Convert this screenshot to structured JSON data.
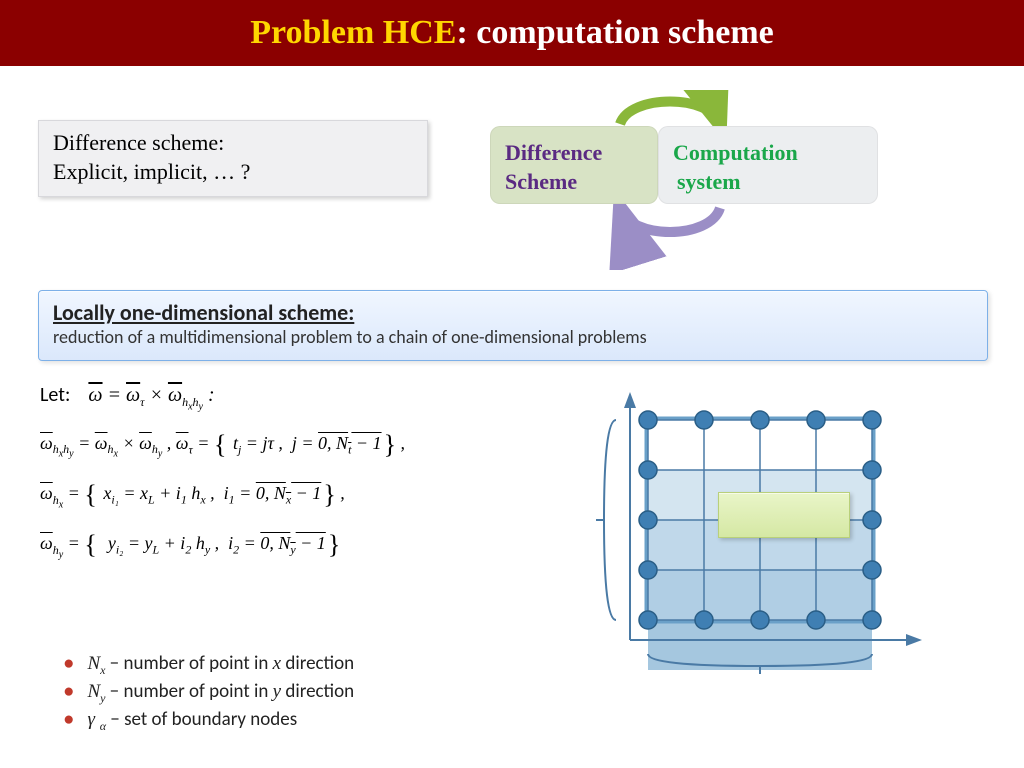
{
  "title": {
    "yellow": "Problem HCE",
    "rest": ": computation scheme"
  },
  "question": {
    "line1": "Difference scheme:",
    "line2": "Explicit,  implicit, … ?"
  },
  "cycle": {
    "left_line1": "Difference",
    "left_line2": "Scheme",
    "right_line1": "Computation",
    "right_line2": "system"
  },
  "lod": {
    "heading": "Locally one-dimensional scheme:",
    "sub": "reduction of a multidimensional problem to a chain of one-dimensional problems"
  },
  "math": {
    "let_label": "Let:",
    "line0_a": "ω̄ = ω̄",
    "line0_b": " × ω̄",
    "line0_tau": "τ",
    "line0_hxhy": "hₓh_y",
    "line0_tail": " :",
    "line1_lhs": "ω̄",
    "line1_hxhy": "hₓh_y",
    "line1_mid": " = ω̄",
    "line1_hx": "hₓ",
    "line1_x": " × ω̄",
    "line1_hy": "h_y",
    "line1_tau_lead": " , ω̄",
    "line1_tau": "τ",
    "line1_set": " = { t_j = jτ ,  j = 0, N_t − 1 } ,",
    "line2_lhs": "ω̄",
    "line2_hx": "hₓ",
    "line2_set": " = { x_{i₁} = x_L + i₁ hₓ ,  i₁ = 0, Nₓ − 1 } ,",
    "line3_lhs": "ω̄",
    "line3_hy": "h_y",
    "line3_set": " = { y_{i₂} = y_L + i₂ h_y ,  i₂ = 0, N_y − 1 }"
  },
  "bullets": {
    "nx_var": "Nₓ",
    "nx_text": " − number of point in ",
    "nx_dir": "x",
    "nx_tail": " direction",
    "ny_var": "N_y",
    "ny_text": " − number of point in ",
    "ny_dir": "y",
    "ny_tail": " direction",
    "gamma_var": "γ",
    "gamma_sub": "α",
    "gamma_text": " − set of boundary nodes"
  },
  "colors": {
    "title_bg": "#8B0000",
    "accent_yellow": "#FFD700",
    "cycle_left_bg": "#d8e3c5",
    "cycle_left_fg": "#5a2a82",
    "cycle_right_bg": "#eceef0",
    "cycle_right_fg": "#1aa74a",
    "node_fill": "#3f7fb3",
    "arrow_green": "#8ab73a",
    "arrow_purple": "#9b8ec6"
  },
  "grid": {
    "cols": 5,
    "rows": 5,
    "row_shades": [
      "#ffffff",
      "#d4e5f0",
      "#c0d8ea",
      "#b0cee4",
      "#a5c7df"
    ]
  }
}
